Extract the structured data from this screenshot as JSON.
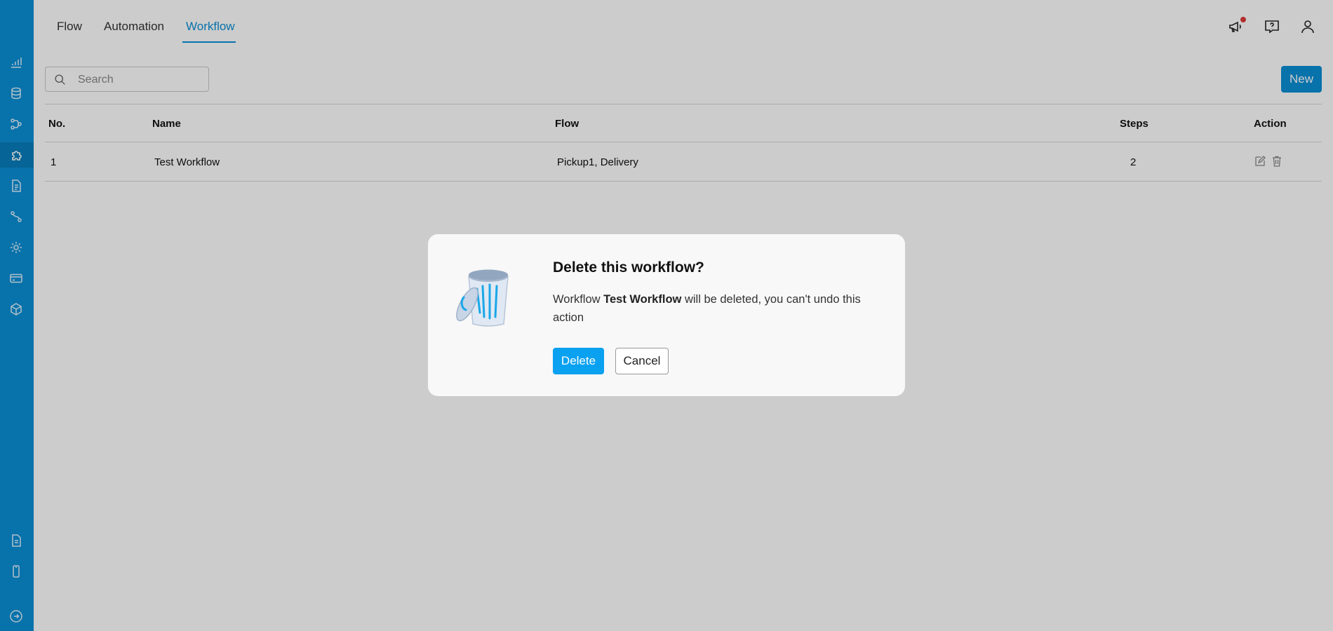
{
  "colors": {
    "accent": "#0a8fd6",
    "delete_button": "#0aa1f0",
    "notification_dot": "#e03a3a"
  },
  "tabs": [
    {
      "label": "Flow",
      "active": false
    },
    {
      "label": "Automation",
      "active": false
    },
    {
      "label": "Workflow",
      "active": true
    }
  ],
  "sidebar": {
    "icons": [
      "bar-chart-icon",
      "database-icon",
      "flow-icon",
      "puzzle-icon",
      "document-icon",
      "route-icon",
      "gear-icon",
      "credit-card-icon",
      "box-icon"
    ],
    "bottom_icons": [
      "file-icon",
      "mobile-icon",
      "logout-icon"
    ],
    "active_icon": "puzzle-icon"
  },
  "header_icons": [
    "megaphone-icon",
    "help-chat-icon",
    "user-icon"
  ],
  "search": {
    "placeholder": "Search",
    "value": ""
  },
  "toolbar": {
    "new_label": "New"
  },
  "table": {
    "columns": [
      "No.",
      "Name",
      "Flow",
      "Steps",
      "Action"
    ],
    "rows": [
      {
        "no": "1",
        "name": "Test Workflow",
        "flow": "Pickup1, Delivery",
        "steps": "2"
      }
    ]
  },
  "modal": {
    "title": "Delete this workflow?",
    "body_prefix": "Workflow ",
    "body_name": "Test Workflow",
    "body_suffix": " will be deleted, you can't undo this action",
    "delete_label": "Delete",
    "cancel_label": "Cancel"
  }
}
